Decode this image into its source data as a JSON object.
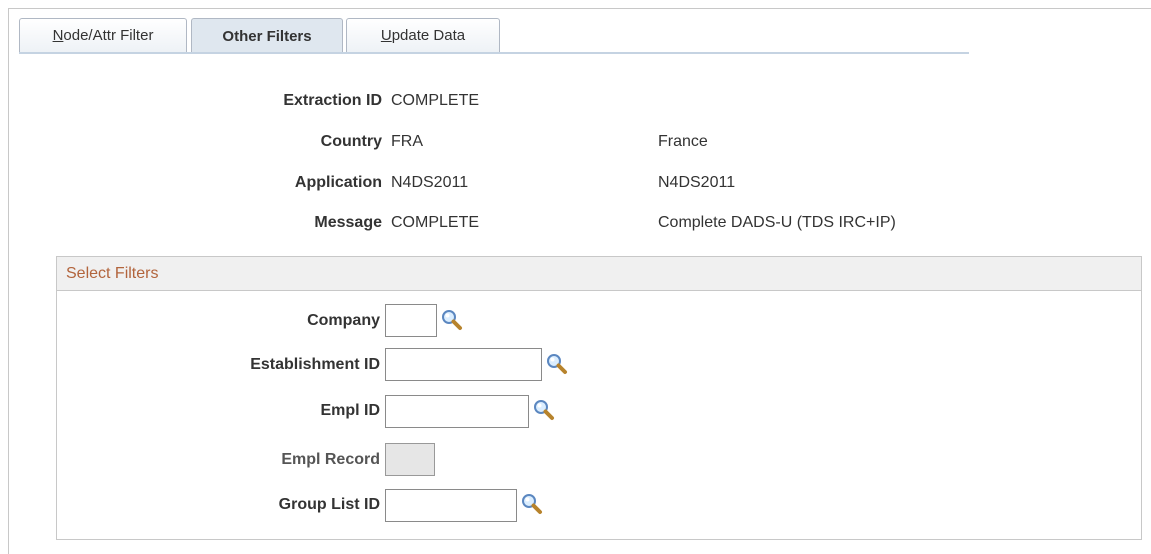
{
  "tabs": [
    {
      "label_prefix": "N",
      "label_rest": "ode/Attr Filter"
    },
    {
      "label": "Other Filters"
    },
    {
      "label_prefix": "U",
      "label_rest": "pdate Data"
    }
  ],
  "header": {
    "extraction_label": "Extraction ID",
    "extraction_value": "COMPLETE",
    "country_label": "Country",
    "country_code": "FRA",
    "country_name": "France",
    "application_label": "Application",
    "application_code": "N4DS2011",
    "application_desc": "N4DS2011",
    "message_label": "Message",
    "message_code": "COMPLETE",
    "message_desc": "Complete DADS-U (TDS IRC+IP)"
  },
  "filters": {
    "title": "Select Filters",
    "company_label": "Company",
    "company_value": "",
    "establishment_label": "Establishment ID",
    "establishment_value": "",
    "emplid_label": "Empl ID",
    "emplid_value": "",
    "emplrecord_label": "Empl Record",
    "emplrecord_value": "",
    "grouplist_label": "Group List ID",
    "grouplist_value": ""
  },
  "icons": {
    "lookup": "magnifier-lookup-icon"
  }
}
